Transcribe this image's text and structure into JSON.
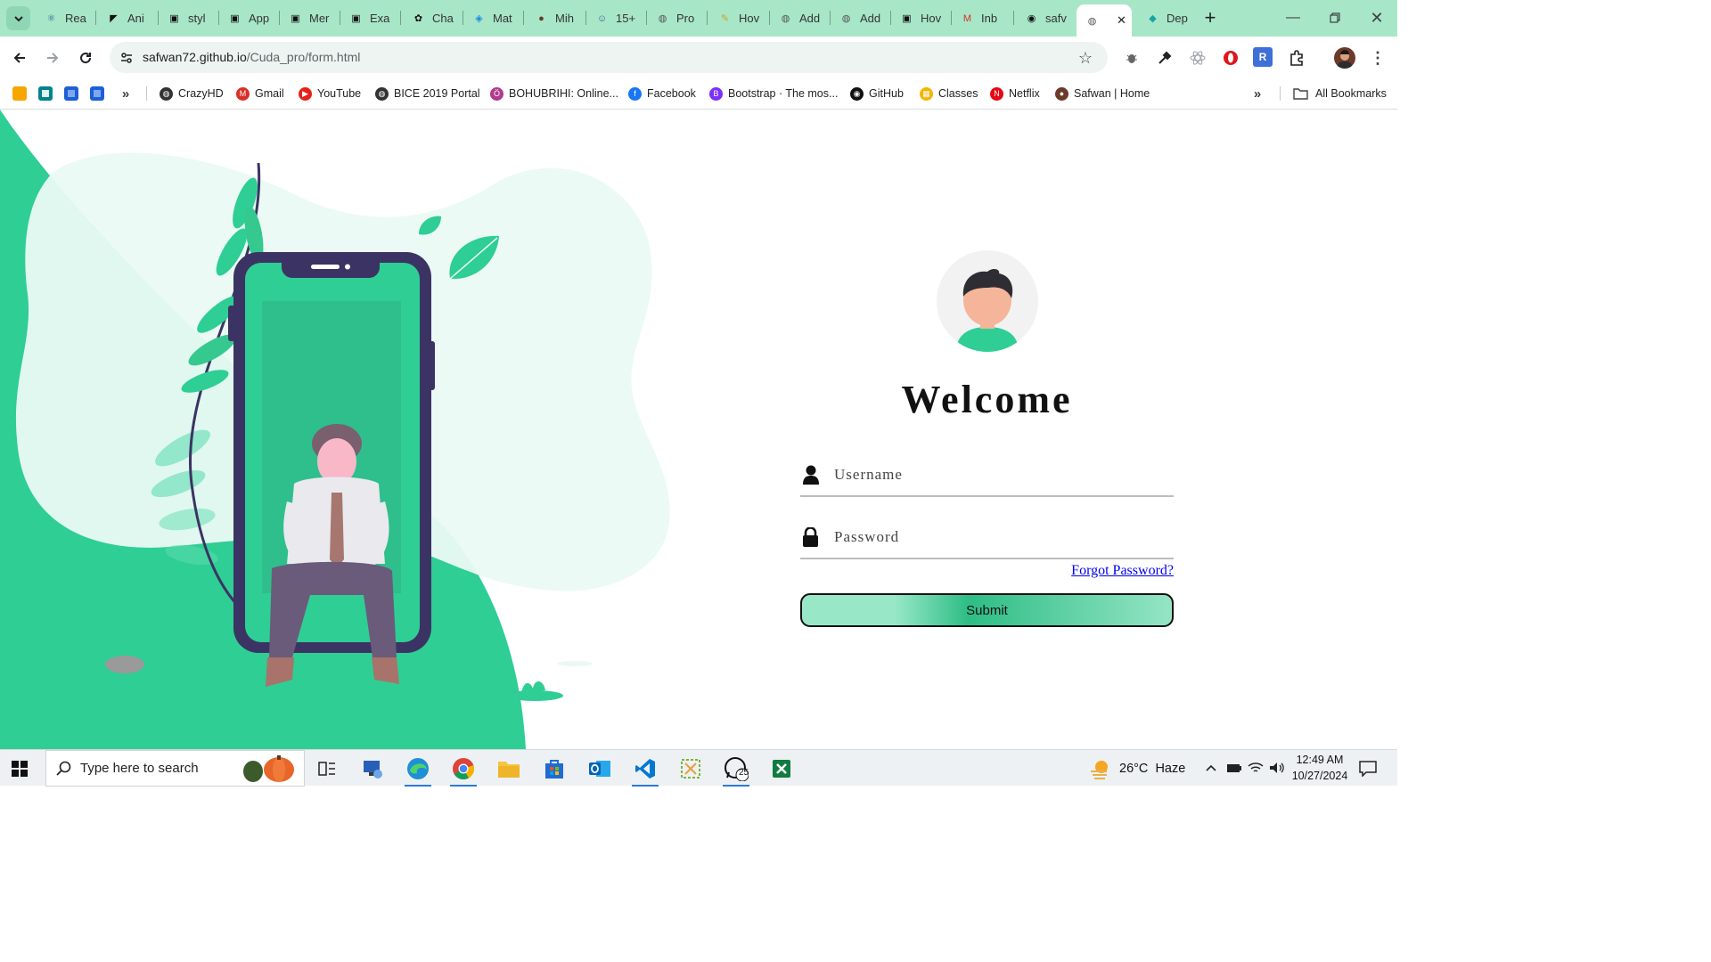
{
  "browser": {
    "tabs": [
      {
        "label": "Rea",
        "icon": "react-icon",
        "color": "#1d5c8e"
      },
      {
        "label": "Ani",
        "icon": "framer-icon",
        "color": "#111111"
      },
      {
        "label": "styl",
        "icon": "codepen-icon",
        "color": "#111111"
      },
      {
        "label": "App",
        "icon": "codepen-icon",
        "color": "#111111"
      },
      {
        "label": "Mer",
        "icon": "codepen-icon",
        "color": "#111111"
      },
      {
        "label": "Exa",
        "icon": "codepen-icon",
        "color": "#111111"
      },
      {
        "label": "Cha",
        "icon": "openai-icon",
        "color": "#111111"
      },
      {
        "label": "Mat",
        "icon": "mui-icon",
        "color": "#1e88e5"
      },
      {
        "label": "Mih",
        "icon": "avatar-icon",
        "color": "#6b3a2a"
      },
      {
        "label": "15+",
        "icon": "profile-icon",
        "color": "#3a5ba0"
      },
      {
        "label": "Pro",
        "icon": "globe-icon",
        "color": "#555555"
      },
      {
        "label": "Hov",
        "icon": "pencil-icon",
        "color": "#d4a017"
      },
      {
        "label": "Add",
        "icon": "globe-icon",
        "color": "#555555"
      },
      {
        "label": "Add",
        "icon": "globe-icon",
        "color": "#555555"
      },
      {
        "label": "Hov",
        "icon": "codepen-icon",
        "color": "#111111"
      },
      {
        "label": "Inb",
        "icon": "gmail-icon",
        "color": "#d93025"
      },
      {
        "label": "safv",
        "icon": "github-icon",
        "color": "#111111"
      },
      {
        "label": "",
        "icon": "globe-icon",
        "color": "#555555",
        "active": true
      },
      {
        "label": "Dep",
        "icon": "diamond-icon",
        "color": "#1aa3a3"
      }
    ],
    "url_host": "safwan72.github.io",
    "url_path": "/Cuda_pro/form.html",
    "bookmarks": [
      {
        "label": "CrazyHD",
        "icon": "globe-icon",
        "color": "#333333"
      },
      {
        "label": "Gmail",
        "icon": "gmail-icon",
        "color": "#d93025"
      },
      {
        "label": "YouTube",
        "icon": "youtube-icon",
        "color": "#e62117"
      },
      {
        "label": "BICE 2019 Portal",
        "icon": "globe-icon",
        "color": "#333333"
      },
      {
        "label": "BOHUBRIHI: Online...",
        "icon": "bohubrihi-icon",
        "color": "#b03a8e"
      },
      {
        "label": "Facebook",
        "icon": "facebook-icon",
        "color": "#1877f2"
      },
      {
        "label": "Bootstrap · The mos...",
        "icon": "bootstrap-icon",
        "color": "#7b2ff7"
      },
      {
        "label": "GitHub",
        "icon": "github-icon",
        "color": "#111111"
      },
      {
        "label": "Classes",
        "icon": "classroom-icon",
        "color": "#f4b400"
      },
      {
        "label": "Netflix",
        "icon": "netflix-icon",
        "color": "#e50914"
      },
      {
        "label": "Safwan | Home",
        "icon": "avatar-icon",
        "color": "#6b3a2a"
      }
    ],
    "all_bookmarks": "All Bookmarks"
  },
  "form": {
    "title": "Welcome",
    "username_placeholder": "Username",
    "password_placeholder": "Password",
    "forgot": "Forgot Password?",
    "submit": "Submit"
  },
  "taskbar": {
    "search_placeholder": "Type here to search",
    "weather": "26°C  Haze",
    "time": "12:49 AM",
    "date": "10/27/2024",
    "whatsapp_badge": "25"
  },
  "colors": {
    "accent_green": "#2ece95",
    "light_green": "#a8e6c8",
    "phone_frame": "#3b3363"
  }
}
